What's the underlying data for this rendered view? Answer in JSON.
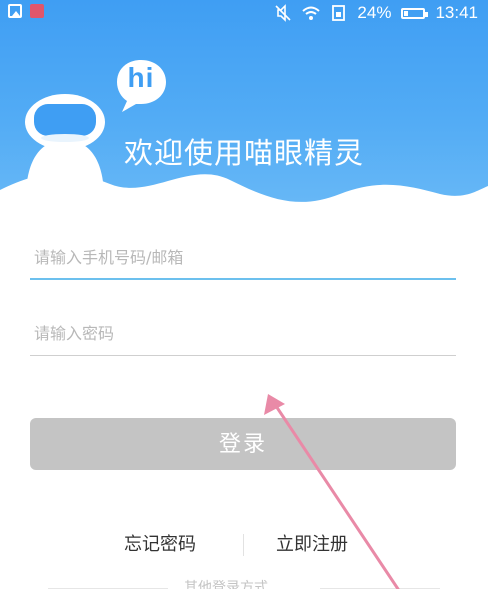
{
  "status_bar": {
    "battery": "24%",
    "battery_level": 0.24,
    "time": "13:41",
    "icons": [
      "gallery-icon",
      "app-icon",
      "mute-icon",
      "wifi-icon",
      "sim-icon",
      "battery-icon"
    ]
  },
  "header": {
    "bubble_text": "hi",
    "welcome": "欢迎使用喵眼精灵"
  },
  "form": {
    "phone_placeholder": "请输入手机号码/邮箱",
    "phone_value": "",
    "password_placeholder": "请输入密码",
    "password_value": "",
    "login_label": "登录"
  },
  "links": {
    "forgot": "忘记密码",
    "register": "立即注册"
  },
  "other_login": {
    "label": "其他登录方式"
  },
  "colors": {
    "header_blue": "#3f9ef3",
    "active_underline": "#6cc0ee",
    "button_disabled": "#c4c4c4",
    "annotation_arrow": "#e98aa7"
  }
}
